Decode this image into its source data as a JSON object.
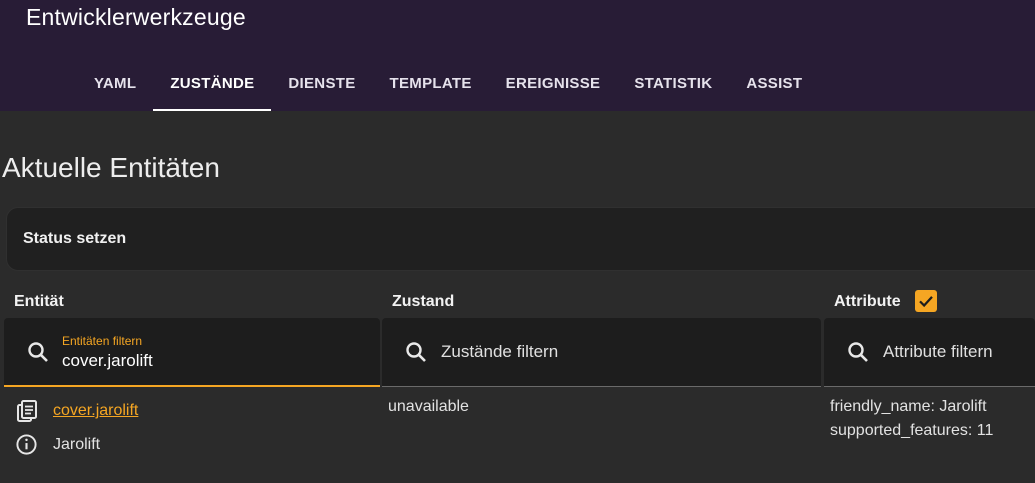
{
  "header": {
    "title": "Entwicklerwerkzeuge",
    "tabs": [
      {
        "label": "YAML",
        "active": false
      },
      {
        "label": "ZUSTÄNDE",
        "active": true
      },
      {
        "label": "DIENSTE",
        "active": false
      },
      {
        "label": "TEMPLATE",
        "active": false
      },
      {
        "label": "EREIGNISSE",
        "active": false
      },
      {
        "label": "STATISTIK",
        "active": false
      },
      {
        "label": "ASSIST",
        "active": false
      }
    ]
  },
  "main": {
    "title": "Aktuelle Entitäten",
    "status_panel_label": "Status setzen",
    "columns": {
      "entity": "Entität",
      "state": "Zustand",
      "attributes": "Attribute"
    },
    "attributes_checkbox_checked": true,
    "filters": {
      "entity": {
        "label": "Entitäten filtern",
        "value": "cover.jarolift"
      },
      "state": {
        "placeholder": "Zustände filtern",
        "value": ""
      },
      "attributes": {
        "placeholder": "Attribute filtern",
        "value": ""
      }
    },
    "rows": [
      {
        "entity_id": "cover.jarolift",
        "friendly_name": "Jarolift",
        "state": "unavailable",
        "attributes": [
          "friendly_name: Jarolift",
          "supported_features: 11"
        ]
      }
    ]
  },
  "colors": {
    "header_bg": "#281c36",
    "accent": "#f5a623",
    "page_bg": "#2b2b2b"
  },
  "icons": {
    "search": "search-icon",
    "copy": "clipboard-icon",
    "info": "info-icon",
    "check": "check-icon"
  }
}
